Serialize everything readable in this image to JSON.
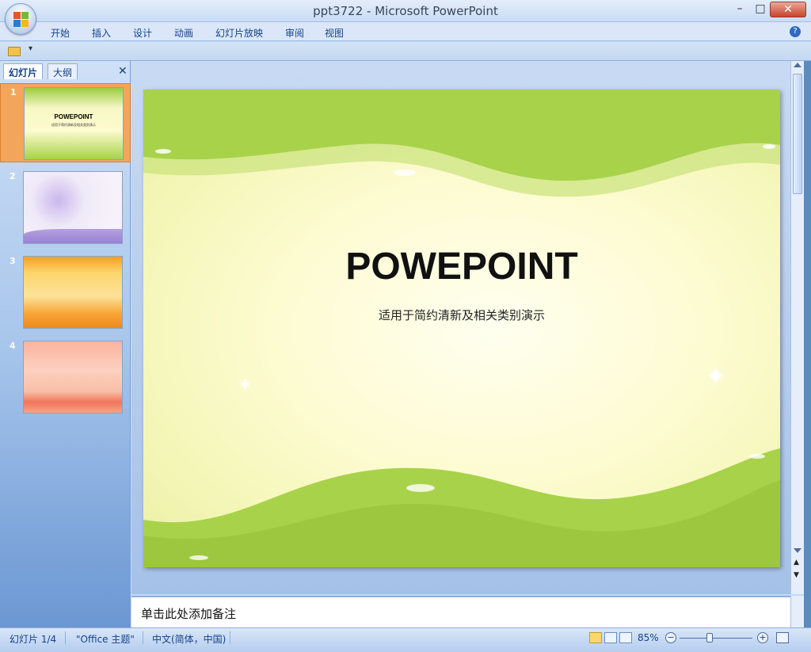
{
  "window": {
    "title": "ppt3722 - Microsoft PowerPoint",
    "minimize": "–",
    "maximize": "□",
    "close": "✕"
  },
  "ribbon": {
    "tabs": [
      "开始",
      "插入",
      "设计",
      "动画",
      "幻灯片放映",
      "审阅",
      "视图"
    ],
    "help_label": "?"
  },
  "qat": {
    "dropdown": "▾"
  },
  "left_pane": {
    "tabs": [
      "幻灯片",
      "大纲"
    ],
    "close": "✕",
    "selected_index": 1,
    "slides": [
      {
        "number": "1",
        "title": "POWEPOINT",
        "subtitle": "适用于简约清新及相关类别演示"
      },
      {
        "number": "2"
      },
      {
        "number": "3"
      },
      {
        "number": "4"
      }
    ]
  },
  "slide": {
    "title": "POWEPOINT",
    "subtitle": "适用于简约清新及相关类别演示"
  },
  "notes": {
    "placeholder": "单击此处添加备注"
  },
  "status": {
    "slide_counter": "幻灯片 1/4",
    "theme": "\"Office 主题\"",
    "language": "中文(简体，中国)",
    "zoom": "85%",
    "zoom_out": "−",
    "zoom_in": "+"
  },
  "colors": {
    "accent": "#15428b",
    "slide_green": "#9ccc41",
    "selected_thumb": "#f3a55b"
  }
}
